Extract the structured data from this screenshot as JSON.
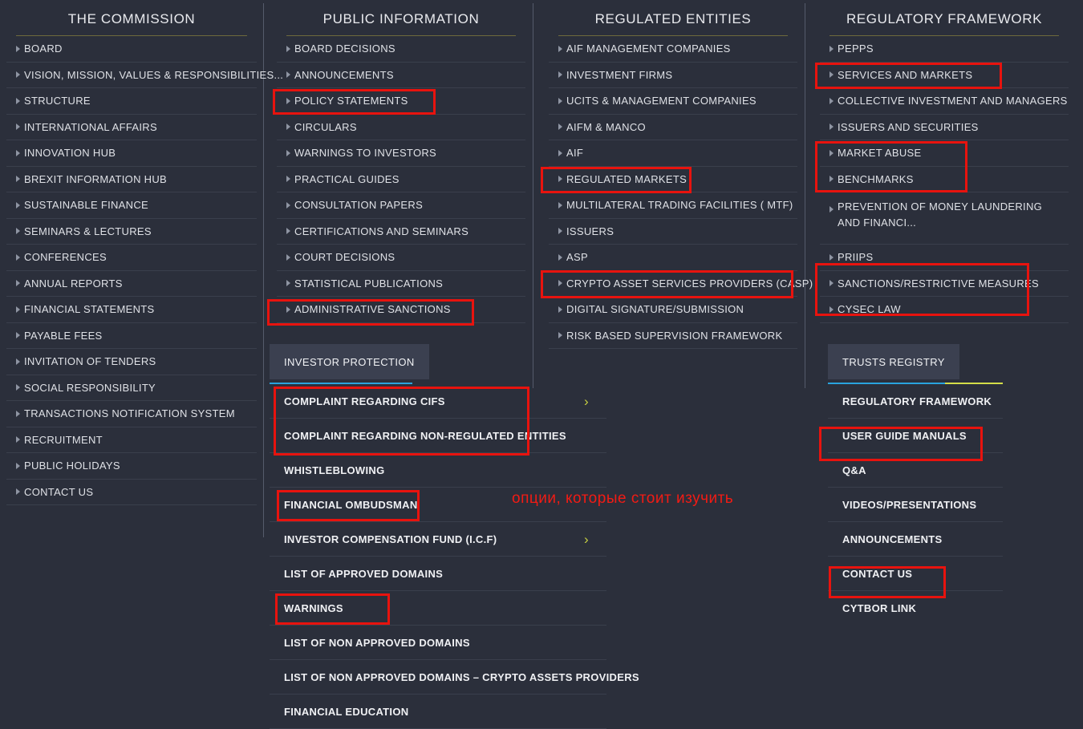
{
  "columns": [
    {
      "id": "the-commission",
      "title": "THE COMMISSION",
      "items": [
        {
          "label": "BOARD"
        },
        {
          "label": "VISION, MISSION, VALUES & RESPONSIBILITIES..."
        },
        {
          "label": "STRUCTURE"
        },
        {
          "label": "INTERNATIONAL AFFAIRS"
        },
        {
          "label": "INNOVATION HUB"
        },
        {
          "label": "BREXIT INFORMATION HUB"
        },
        {
          "label": "SUSTAINABLE FINANCE"
        },
        {
          "label": "SEMINARS & LECTURES"
        },
        {
          "label": "CONFERENCES"
        },
        {
          "label": "ANNUAL REPORTS"
        },
        {
          "label": "FINANCIAL STATEMENTS"
        },
        {
          "label": "PAYABLE FEES"
        },
        {
          "label": "INVITATION OF TENDERS"
        },
        {
          "label": "SOCIAL RESPONSIBILITY"
        },
        {
          "label": "TRANSACTIONS NOTIFICATION SYSTEM"
        },
        {
          "label": "RECRUITMENT"
        },
        {
          "label": "PUBLIC HOLIDAYS"
        },
        {
          "label": "CONTACT US"
        }
      ]
    },
    {
      "id": "public-information",
      "title": "PUBLIC INFORMATION",
      "items": [
        {
          "label": "BOARD DECISIONS"
        },
        {
          "label": "ANNOUNCEMENTS"
        },
        {
          "label": "POLICY STATEMENTS"
        },
        {
          "label": "CIRCULARS"
        },
        {
          "label": "WARNINGS TO INVESTORS"
        },
        {
          "label": "PRACTICAL GUIDES"
        },
        {
          "label": "CONSULTATION PAPERS"
        },
        {
          "label": "CERTIFICATIONS AND SEMINARS"
        },
        {
          "label": "COURT DECISIONS"
        },
        {
          "label": "STATISTICAL PUBLICATIONS"
        },
        {
          "label": "ADMINISTRATIVE SANCTIONS"
        }
      ]
    },
    {
      "id": "regulated-entities",
      "title": "REGULATED ENTITIES",
      "items": [
        {
          "label": "AIF MANAGEMENT COMPANIES"
        },
        {
          "label": "INVESTMENT FIRMS"
        },
        {
          "label": "UCITS & MANAGEMENT COMPANIES"
        },
        {
          "label": "AIFM & MANCO"
        },
        {
          "label": "AIF"
        },
        {
          "label": "REGULATED MARKETS"
        },
        {
          "label": "MULTILATERAL TRADING FACILITIES ( MTF)"
        },
        {
          "label": "ISSUERS"
        },
        {
          "label": "ASP"
        },
        {
          "label": "CRYPTO ASSET SERVICES PROVIDERS (CASP)"
        },
        {
          "label": "DIGITAL SIGNATURE/SUBMISSION"
        },
        {
          "label": "RISK BASED SUPERVISION FRAMEWORK"
        }
      ]
    },
    {
      "id": "regulatory-framework",
      "title": "REGULATORY FRAMEWORK",
      "items": [
        {
          "label": "PEPPS"
        },
        {
          "label": "SERVICES AND MARKETS"
        },
        {
          "label": "COLLECTIVE INVESTMENT AND MANAGERS"
        },
        {
          "label": "ISSUERS AND SECURITIES"
        },
        {
          "label": "MARKET ABUSE"
        },
        {
          "label": "BENCHMARKS"
        },
        {
          "label": "PREVENTION OF MONEY LAUNDERING AND FINANCI..."
        },
        {
          "label": "PRIIPS"
        },
        {
          "label": "SANCTIONS/RESTRICTIVE MEASURES"
        },
        {
          "label": "CYSEC LAW"
        }
      ]
    }
  ],
  "investor_protection": {
    "tab_label": "INVESTOR PROTECTION",
    "items": [
      {
        "label": "COMPLAINT REGARDING CIFS",
        "chevron": "›"
      },
      {
        "label": "COMPLAINT REGARDING NON-REGULATED ENTITIES",
        "chevron": ""
      },
      {
        "label": "WHISTLEBLOWING",
        "chevron": ""
      },
      {
        "label": "FINANCIAL OMBUDSMAN",
        "chevron": ""
      },
      {
        "label": "INVESTOR COMPENSATION FUND (I.C.F)",
        "chevron": "›"
      },
      {
        "label": "LIST OF APPROVED DOMAINS",
        "chevron": ""
      },
      {
        "label": "WARNINGS",
        "chevron": ""
      },
      {
        "label": "LIST OF NON APPROVED DOMAINS",
        "chevron": ""
      },
      {
        "label": "LIST OF NON APPROVED DOMAINS – CRYPTO ASSETS PROVIDERS",
        "chevron": ""
      },
      {
        "label": "FINANCIAL EDUCATION",
        "chevron": ""
      }
    ]
  },
  "trusts_registry": {
    "tab_label": "TRUSTS REGISTRY",
    "items": [
      {
        "label": "REGULATORY FRAMEWORK"
      },
      {
        "label": "USER GUIDE MANUALS"
      },
      {
        "label": "Q&A"
      },
      {
        "label": "VIDEOS/PRESENTATIONS"
      },
      {
        "label": "ANNOUNCEMENTS"
      },
      {
        "label": "CONTACT US"
      },
      {
        "label": "CYTBOR LINK"
      }
    ]
  },
  "annotation": {
    "text": "опции, которые стоит изучить",
    "color": "#f21b14"
  },
  "colors": {
    "background": "#2b2f3b",
    "tab_background": "#3b4050",
    "tab_underline_blue": "#29a3dd",
    "tab_underline_yellow": "#d4dd49",
    "header_rule_olive": "#6e6a3c",
    "annotation_red": "#e8130e",
    "chevron_yellow": "#c6cf42"
  },
  "highlight_boxes": [
    {
      "target": "POLICY STATEMENTS"
    },
    {
      "target": "ADMINISTRATIVE SANCTIONS"
    },
    {
      "target": "REGULATED MARKETS"
    },
    {
      "target": "CRYPTO ASSET SERVICES PROVIDERS (CASP)"
    },
    {
      "target": "SERVICES AND MARKETS"
    },
    {
      "target": "MARKET ABUSE / BENCHMARKS"
    },
    {
      "target": "SANCTIONS/RESTRICTIVE MEASURES / CYSEC LAW"
    },
    {
      "target": "COMPLAINT REGARDING CIFS / COMPLAINT REGARDING NON-REGULATED ENTITIES"
    },
    {
      "target": "FINANCIAL OMBUDSMAN"
    },
    {
      "target": "WARNINGS"
    },
    {
      "target": "USER GUIDE MANUALS"
    },
    {
      "target": "CONTACT US"
    }
  ]
}
